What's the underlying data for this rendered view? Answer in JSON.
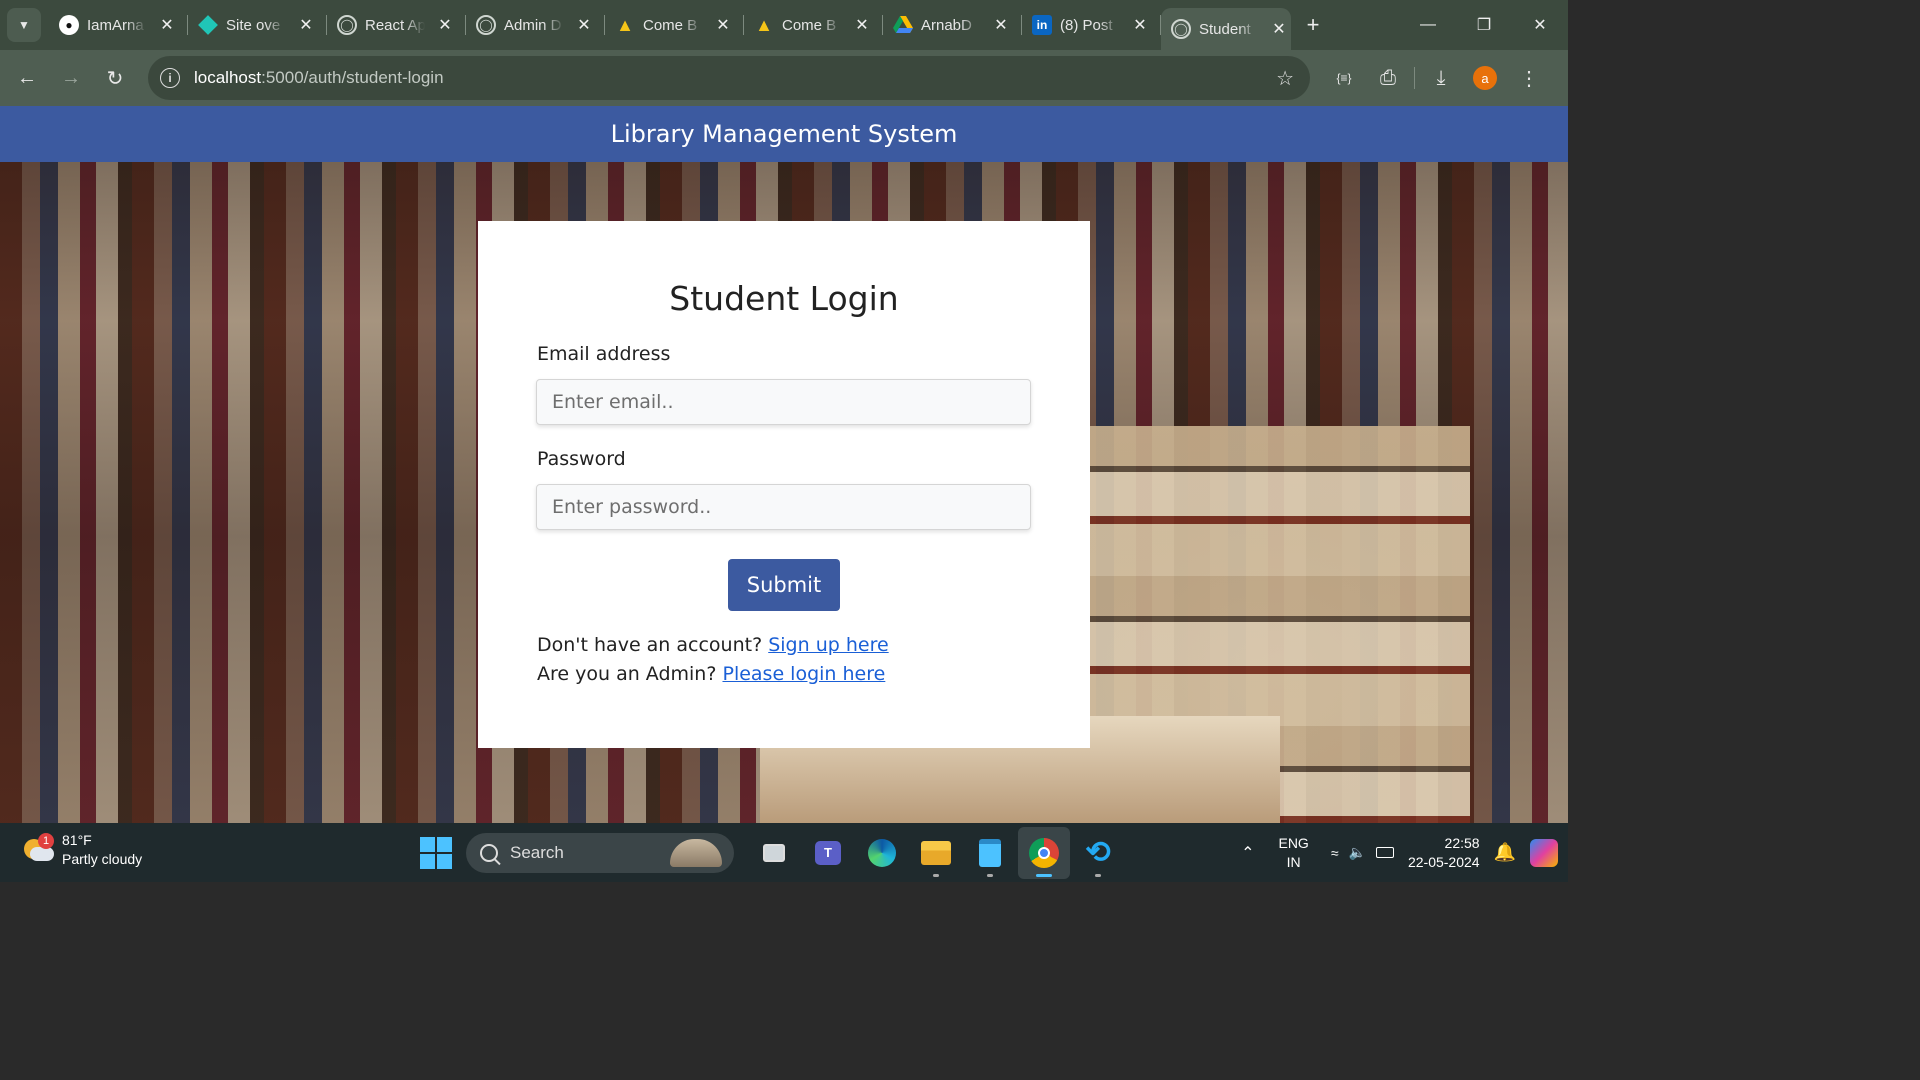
{
  "browser": {
    "tabs": [
      {
        "title": "IamArna",
        "icon": "github-icon"
      },
      {
        "title": "Site ove",
        "icon": "netlify-icon"
      },
      {
        "title": "React Ap",
        "icon": "globe-icon"
      },
      {
        "title": "Admin D",
        "icon": "globe-icon"
      },
      {
        "title": "Come B",
        "icon": "yellow-figure-icon"
      },
      {
        "title": "Come B",
        "icon": "yellow-figure-icon"
      },
      {
        "title": "ArnabD",
        "icon": "google-drive-icon"
      },
      {
        "title": "(8) Post",
        "icon": "linkedin-icon"
      },
      {
        "title": "Student",
        "icon": "globe-icon",
        "active": true
      }
    ],
    "url_host": "localhost",
    "url_path": ":5000/auth/student-login",
    "avatar_letter": "a"
  },
  "app": {
    "header_title": "Library Management System"
  },
  "login": {
    "heading": "Student Login",
    "email_label": "Email address",
    "email_placeholder": "Enter email..",
    "password_label": "Password",
    "password_placeholder": "Enter password..",
    "submit_label": "Submit",
    "signup_prompt": "Don't have an account?",
    "signup_link": "Sign up here",
    "admin_prompt": "Are you an Admin?",
    "admin_link": "Please login here"
  },
  "taskbar": {
    "weather_badge": "1",
    "temperature": "81°F",
    "condition": "Partly cloudy",
    "search_label": "Search",
    "lang_top": "ENG",
    "lang_bottom": "IN",
    "time": "22:58",
    "date": "22-05-2024"
  },
  "colors": {
    "primary": "#3c5aa0",
    "link": "#1a5fd6"
  }
}
